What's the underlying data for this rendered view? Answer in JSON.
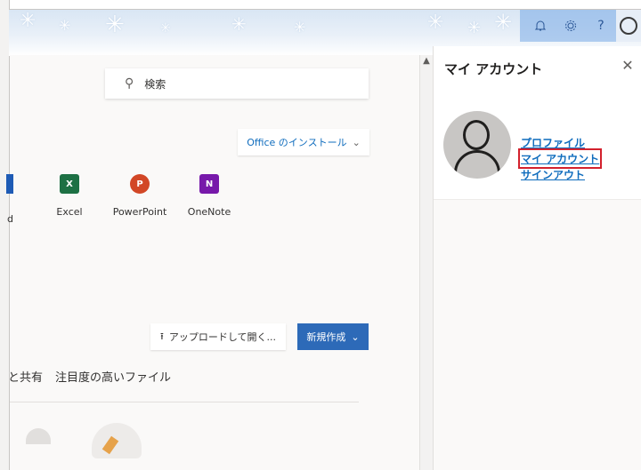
{
  "header": {
    "icons": [
      "bell-icon",
      "gear-icon",
      "help-icon",
      "avatar-icon"
    ]
  },
  "main": {
    "search_placeholder": "検索",
    "install_label": "Office のインストール",
    "apps": [
      {
        "name": "Excel",
        "letter": "X",
        "color": "#1d7044"
      },
      {
        "name": "PowerPoint",
        "letter": "P",
        "color": "#d24726"
      },
      {
        "name": "OneNote",
        "letter": "N",
        "color": "#7719aa"
      }
    ],
    "partial_app_label": "d",
    "upload_label": "アップロードして開く...",
    "new_label": "新規作成",
    "file_tabs": [
      "と共有",
      "注目度の高いファイル"
    ]
  },
  "panel": {
    "title": "マイ アカウント",
    "links": {
      "profile": "プロファイル",
      "my_account": "マイ アカウント",
      "sign_out": "サインアウト"
    }
  },
  "colors": {
    "accent": "#2d6ab8",
    "link": "#0f6cbd",
    "highlight": "#d3212d"
  }
}
